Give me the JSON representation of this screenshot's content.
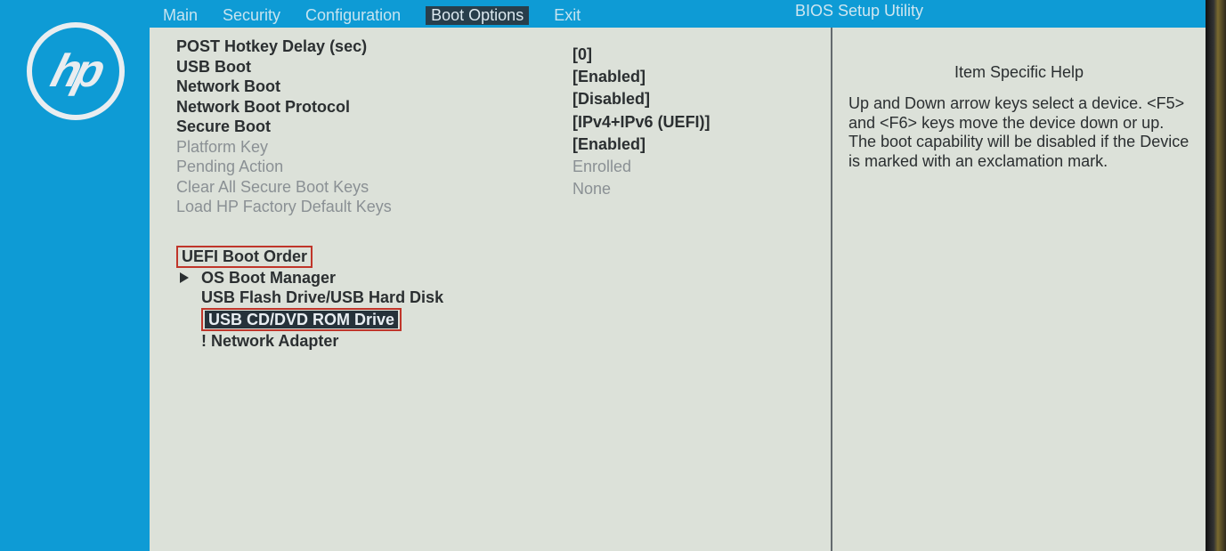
{
  "utility_title": "BIOS Setup Utility",
  "tabs": {
    "main": "Main",
    "security": "Security",
    "configuration": "Configuration",
    "boot_options": "Boot Options",
    "exit": "Exit"
  },
  "settings": [
    {
      "label": "POST Hotkey Delay (sec)",
      "value": "[0]",
      "dim": false
    },
    {
      "label": "USB Boot",
      "value": "[Enabled]",
      "dim": false
    },
    {
      "label": "Network Boot",
      "value": "[Disabled]",
      "dim": false
    },
    {
      "label": "Network Boot Protocol",
      "value": "[IPv4+IPv6 (UEFI)]",
      "dim": false
    },
    {
      "label": "Secure Boot",
      "value": "[Enabled]",
      "dim": false
    },
    {
      "label": "Platform Key",
      "value": "Enrolled",
      "dim": true
    },
    {
      "label": "Pending Action",
      "value": "None",
      "dim": true
    },
    {
      "label": "Clear All Secure Boot Keys",
      "value": "",
      "dim": true
    },
    {
      "label": "Load HP Factory Default Keys",
      "value": "",
      "dim": true
    }
  ],
  "boot_section_title": "UEFI Boot Order",
  "boot_order": [
    {
      "label": "OS Boot Manager",
      "pointed": true,
      "highlighted": false
    },
    {
      "label": "USB Flash Drive/USB Hard Disk",
      "pointed": false,
      "highlighted": false
    },
    {
      "label": "USB CD/DVD ROM Drive",
      "pointed": false,
      "highlighted": true
    },
    {
      "label": "! Network Adapter",
      "pointed": false,
      "highlighted": false
    }
  ],
  "help": {
    "title": "Item Specific Help",
    "body": "Up and Down arrow keys select a device. <F5> and <F6> keys move the device down or up.\nThe boot capability will be disabled if the Device is marked with an exclamation mark."
  }
}
